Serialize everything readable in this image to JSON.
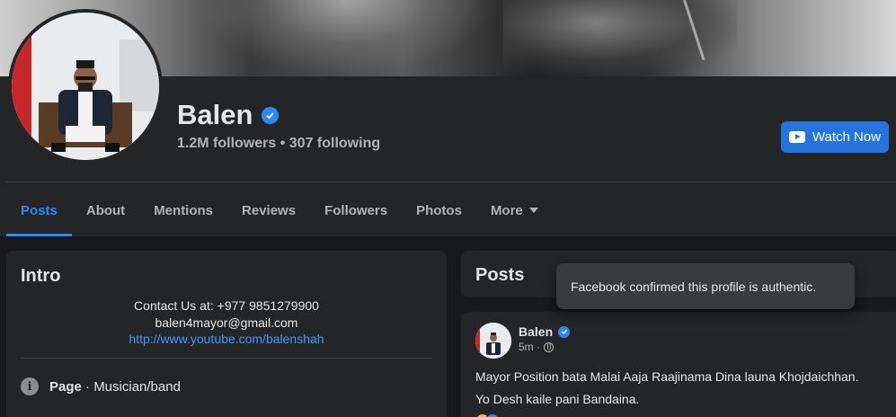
{
  "profile": {
    "name": "Balen",
    "followers": "1.2M followers",
    "separator": "•",
    "following": "307 following",
    "watch_label": "Watch Now"
  },
  "tabs": [
    {
      "label": "Posts",
      "active": true
    },
    {
      "label": "About"
    },
    {
      "label": "Mentions"
    },
    {
      "label": "Reviews"
    },
    {
      "label": "Followers"
    },
    {
      "label": "Photos"
    },
    {
      "label": "More"
    }
  ],
  "intro": {
    "title": "Intro",
    "contact": "Contact Us at: +977 9851279900",
    "email": "balen4mayor@gmail.com",
    "link": "http://www.youtube.com/balenshah",
    "page_label": "Page",
    "page_category": " · Musician/band"
  },
  "posts": {
    "title": "Posts",
    "tooltip": "Facebook confirmed this profile is authentic.",
    "item": {
      "author": "Balen",
      "time": "5m ·",
      "line1": "Mayor Position bata Malai Aaja Raajinama Dina launa Khojdaichhan.",
      "line2": "Yo Desh kaile pani Bandaina."
    }
  },
  "colors": {
    "accent": "#2d88ff",
    "button": "#2374e1",
    "background": "#18191a",
    "card": "#242526"
  },
  "icons": [
    "verified-icon",
    "youtube-icon",
    "chevron-down-icon",
    "info-icon",
    "globe-icon"
  ]
}
